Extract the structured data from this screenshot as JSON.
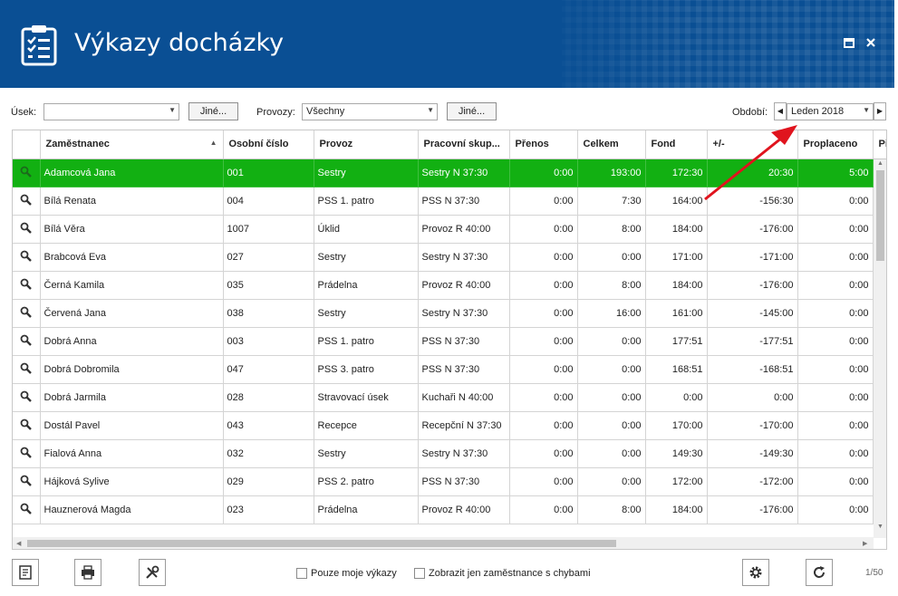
{
  "window": {
    "title": "Výkazy docházky"
  },
  "filters": {
    "usek_label": "Úsek:",
    "usek_value": "",
    "jine1": "Jiné...",
    "provozy_label": "Provozy:",
    "provozy_value": "Všechny",
    "jine2": "Jiné...",
    "obdobi_label": "Období:",
    "obdobi_value": "Leden 2018"
  },
  "table": {
    "columns": [
      "Zaměstnanec",
      "Osobní číslo",
      "Provoz",
      "Pracovní skup...",
      "Přenos",
      "Celkem",
      "Fond",
      "+/-",
      "Proplaceno",
      "Pi"
    ],
    "rows": [
      [
        "Adamcová Jana",
        "001",
        "Sestry",
        "Sestry N 37:30",
        "0:00",
        "193:00",
        "172:30",
        "20:30",
        "5:00"
      ],
      [
        "Bílá Renata",
        "004",
        "PSS 1. patro",
        "PSS N 37:30",
        "0:00",
        "7:30",
        "164:00",
        "-156:30",
        "0:00"
      ],
      [
        "Bílá Věra",
        "1007",
        "Úklid",
        "Provoz R 40:00",
        "0:00",
        "8:00",
        "184:00",
        "-176:00",
        "0:00"
      ],
      [
        "Brabcová Eva",
        "027",
        "Sestry",
        "Sestry N 37:30",
        "0:00",
        "0:00",
        "171:00",
        "-171:00",
        "0:00"
      ],
      [
        "Černá Kamila",
        "035",
        "Prádelna",
        "Provoz R 40:00",
        "0:00",
        "8:00",
        "184:00",
        "-176:00",
        "0:00"
      ],
      [
        "Červená Jana",
        "038",
        "Sestry",
        "Sestry N 37:30",
        "0:00",
        "16:00",
        "161:00",
        "-145:00",
        "0:00"
      ],
      [
        "Dobrá Anna",
        "003",
        "PSS 1. patro",
        "PSS N 37:30",
        "0:00",
        "0:00",
        "177:51",
        "-177:51",
        "0:00"
      ],
      [
        "Dobrá Dobromila",
        "047",
        "PSS 3. patro",
        "PSS N 37:30",
        "0:00",
        "0:00",
        "168:51",
        "-168:51",
        "0:00"
      ],
      [
        "Dobrá Jarmila",
        "028",
        "Stravovací úsek",
        "Kuchaři N 40:00",
        "0:00",
        "0:00",
        "0:00",
        "0:00",
        "0:00"
      ],
      [
        "Dostál Pavel",
        "043",
        "Recepce",
        "Recepční N 37:30",
        "0:00",
        "0:00",
        "170:00",
        "-170:00",
        "0:00"
      ],
      [
        "Fialová Anna",
        "032",
        "Sestry",
        "Sestry N 37:30",
        "0:00",
        "0:00",
        "149:30",
        "-149:30",
        "0:00"
      ],
      [
        "Hájková Sylive",
        "029",
        "PSS 2. patro",
        "PSS N 37:30",
        "0:00",
        "0:00",
        "172:00",
        "-172:00",
        "0:00"
      ],
      [
        "Hauznerová Magda",
        "023",
        "Prádelna",
        "Provoz R 40:00",
        "0:00",
        "8:00",
        "184:00",
        "-176:00",
        "0:00"
      ]
    ]
  },
  "footer": {
    "chk_moje": "Pouze moje výkazy",
    "chk_chyby": "Zobrazit jen zaměstnance s chybami",
    "pager": "1/50"
  },
  "colors": {
    "header_bg": "#0a4f94",
    "selected_row": "#12b012",
    "arrow": "#e0141e"
  }
}
